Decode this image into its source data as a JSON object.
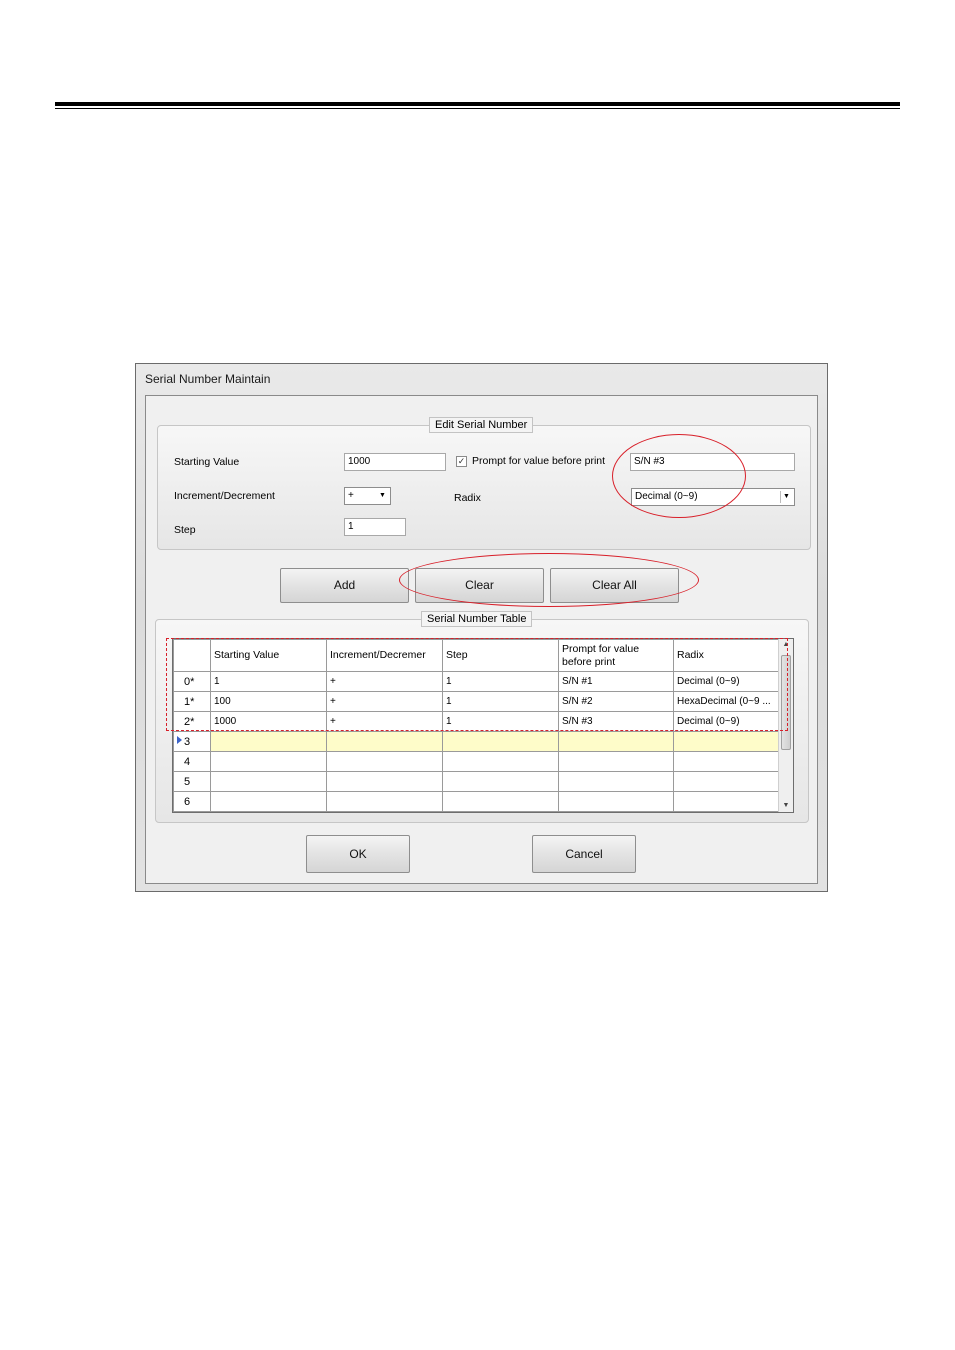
{
  "window": {
    "title": "Serial Number Maintain"
  },
  "edit_group": {
    "legend": "Edit Serial Number",
    "starting_value_label": "Starting Value",
    "starting_value": "1000",
    "prompt_checked": true,
    "prompt_label": "Prompt for value before print",
    "prompt_value": "S/N #3",
    "increment_label": "Increment/Decrement",
    "increment_value": "+",
    "radix_label": "Radix",
    "radix_value": "Decimal (0~9)",
    "step_label": "Step",
    "step_value": "1"
  },
  "buttons": {
    "add": "Add",
    "clear": "Clear",
    "clear_all": "Clear All",
    "ok": "OK",
    "cancel": "Cancel"
  },
  "table_group": {
    "legend": "Serial Number Table"
  },
  "table": {
    "headers": [
      "Starting Value",
      "Increment/Decremer",
      "Step",
      "Prompt for value before print",
      "Radix"
    ],
    "rows": [
      {
        "id": "0*",
        "cells": [
          "1",
          "+",
          "1",
          "S/N #1",
          "Decimal (0~9)"
        ]
      },
      {
        "id": "1*",
        "cells": [
          "100",
          "+",
          "1",
          "S/N #2",
          "HexaDecimal (0~9 ..."
        ]
      },
      {
        "id": "2*",
        "cells": [
          "1000",
          "+",
          "1",
          "S/N #3",
          "Decimal (0~9)"
        ]
      },
      {
        "id": "3",
        "cells": [
          "",
          "",
          "",
          "",
          ""
        ]
      },
      {
        "id": "4",
        "cells": [
          "",
          "",
          "",
          "",
          ""
        ]
      },
      {
        "id": "5",
        "cells": [
          "",
          "",
          "",
          "",
          ""
        ]
      },
      {
        "id": "6",
        "cells": [
          "",
          "",
          "",
          "",
          ""
        ]
      }
    ]
  },
  "icons": {
    "checkbox": "check-icon",
    "dropdown": "chevron-down-icon",
    "row_pointer": "row-pointer-icon"
  },
  "colors": {
    "annotation": "#d8202a",
    "new_row": "#fefcc9"
  }
}
